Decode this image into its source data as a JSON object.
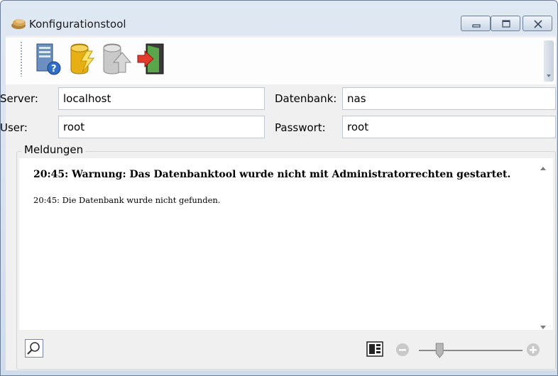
{
  "window": {
    "title": "Konfigurationstool"
  },
  "toolbar": {
    "buttons": [
      {
        "icon": "server-help-icon"
      },
      {
        "icon": "database-lightning-icon"
      },
      {
        "icon": "database-upload-icon"
      },
      {
        "icon": "exit-door-icon"
      }
    ]
  },
  "form": {
    "server_label": "Server:",
    "server_value": "localhost",
    "database_label": "Datenbank:",
    "database_value": "nas",
    "user_label": "User:",
    "user_value": "root",
    "password_label": "Passwort:",
    "password_value": "root"
  },
  "messages": {
    "group_title": "Meldungen",
    "items": [
      {
        "text": "20:45: Warnung: Das Datenbanktool wurde nicht mit Administratorrechten gestartet.",
        "bold": true
      },
      {
        "text": "20:45: Die Datenbank wurde nicht gefunden.",
        "bold": false
      }
    ]
  },
  "zoom": {
    "level_fraction": 0.2
  }
}
